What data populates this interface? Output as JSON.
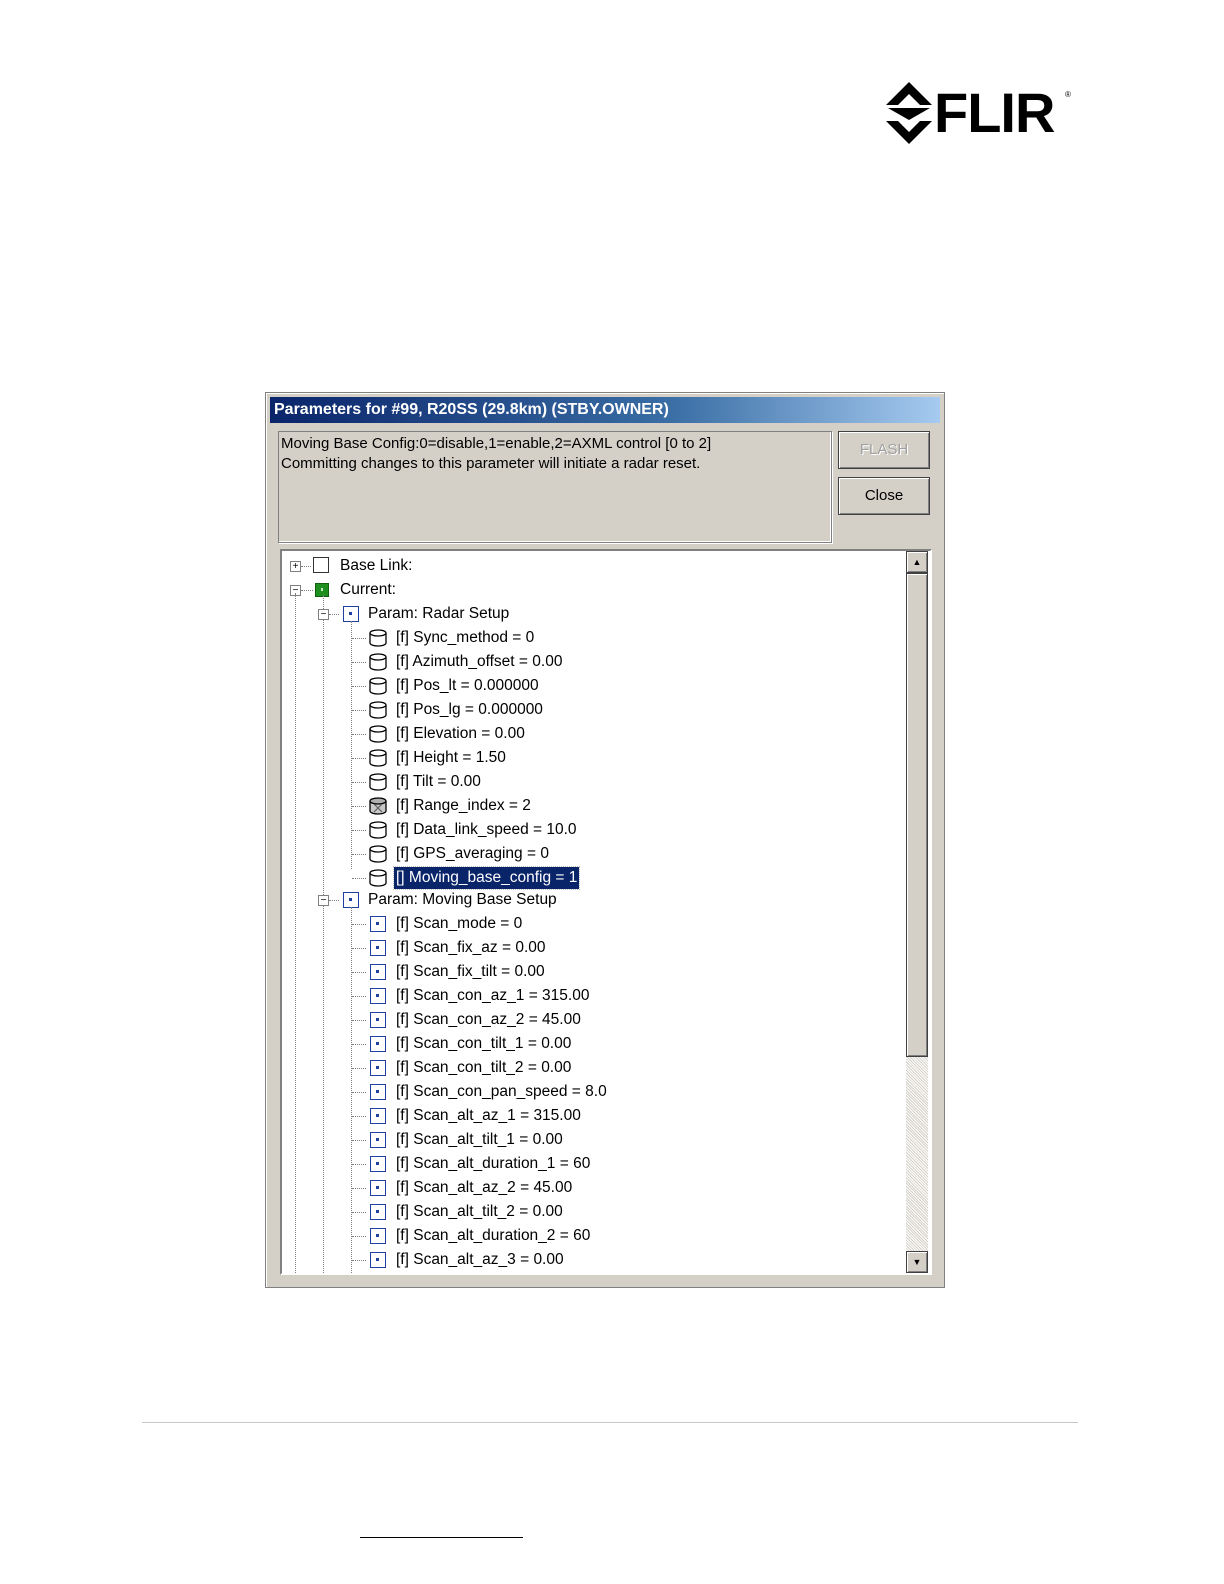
{
  "brand": {
    "logo_text": "FLIR",
    "logo_mark": "®"
  },
  "window": {
    "title": "Parameters for #99, R20SS (29.8km) (STBY.OWNER)"
  },
  "description": {
    "line1": "Moving Base Config:0=disable,1=enable,2=AXML control [0 to 2]",
    "line2": "Committing changes to this parameter will initiate a radar reset."
  },
  "buttons": {
    "flash_label": "FLASH",
    "close_label": "Close"
  },
  "tree": {
    "base_link": "Base Link:",
    "current": "Current:",
    "radar_setup": {
      "label": "Param: Radar Setup",
      "items": [
        "[f] Sync_method = 0",
        "[f] Azimuth_offset = 0.00",
        "[f] Pos_lt = 0.000000",
        "[f] Pos_lg = 0.000000",
        "[f] Elevation = 0.00",
        "[f] Height = 1.50",
        "[f] Tilt = 0.00",
        "[f] Range_index = 2",
        "[f] Data_link_speed = 10.0",
        "[f] GPS_averaging = 0",
        "[] Moving_base_config = 1"
      ],
      "selected_item": "[] Moving_base_config = 1",
      "disabled_item": "[f] Range_index = 2"
    },
    "moving_base_setup": {
      "label": "Param: Moving Base Setup",
      "items": [
        "[f] Scan_mode = 0",
        "[f] Scan_fix_az = 0.00",
        "[f] Scan_fix_tilt = 0.00",
        "[f] Scan_con_az_1 = 315.00",
        "[f] Scan_con_az_2 = 45.00",
        "[f] Scan_con_tilt_1 = 0.00",
        "[f] Scan_con_tilt_2 = 0.00",
        "[f] Scan_con_pan_speed = 8.0",
        "[f] Scan_alt_az_1 = 315.00",
        "[f] Scan_alt_tilt_1 = 0.00",
        "[f] Scan_alt_duration_1 = 60",
        "[f] Scan_alt_az_2 = 45.00",
        "[f] Scan_alt_tilt_2 = 0.00",
        "[f] Scan_alt_duration_2 = 60",
        "[f] Scan_alt_az_3 = 0.00"
      ]
    }
  },
  "colors": {
    "selection": "#0a246a",
    "title_bar": "#0a246a",
    "current_icon": "#1e8f1e",
    "param_icon": "#2040a0"
  }
}
